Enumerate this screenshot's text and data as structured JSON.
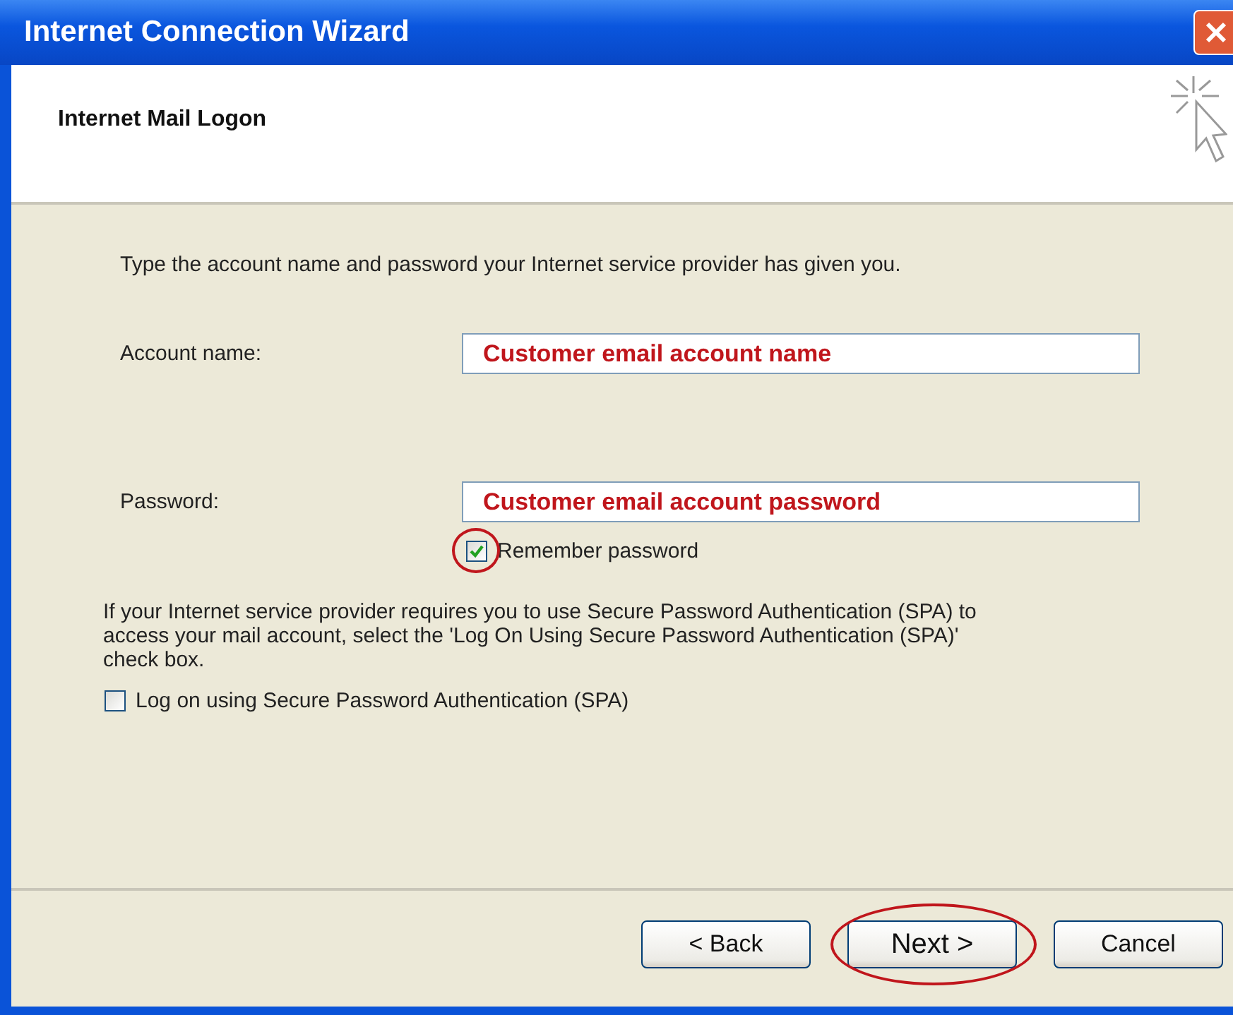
{
  "window": {
    "title": "Internet Connection Wizard"
  },
  "header": {
    "title": "Internet Mail Logon"
  },
  "intro": "Type the account name and password your Internet service provider has given you.",
  "fields": [
    {
      "label": "Account name:",
      "value": "Customer email account name"
    },
    {
      "label": "Password:",
      "value": "Customer email account password"
    }
  ],
  "remember_password": {
    "label": "Remember password",
    "checked": true,
    "highlighted": true
  },
  "spa_note": "If your Internet service provider requires you to use Secure Password Authentication (SPA) to access your mail account, select the 'Log On Using Secure Password Authentication (SPA)' check box.",
  "spa_checkbox": {
    "label": "Log on using Secure Password Authentication (SPA)",
    "checked": false,
    "highlighted": false
  },
  "buttons": [
    {
      "label": "< Back",
      "highlighted": false
    },
    {
      "label": "Next >",
      "highlighted": true
    },
    {
      "label": "Cancel",
      "highlighted": false
    }
  ]
}
